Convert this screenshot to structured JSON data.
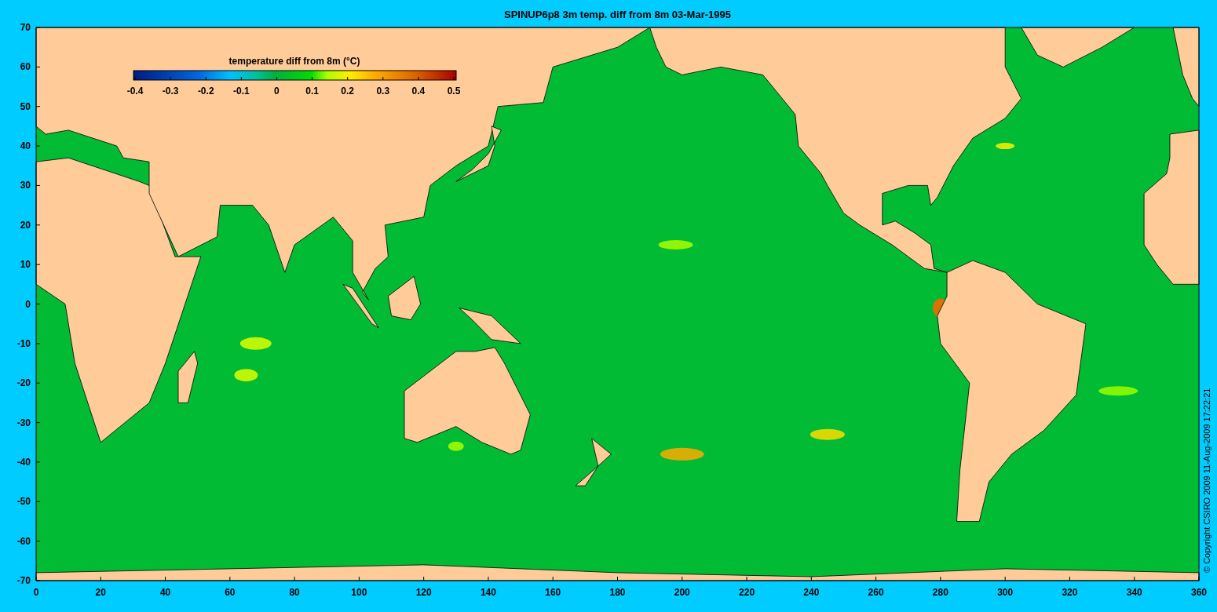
{
  "title": "SPINUP6p8 3m temp.  diff from 8m 03-Mar-1995",
  "colorbar": {
    "label": "temperature  diff from 8m (°C)",
    "ticks": [
      "-0.4",
      "-0.3",
      "-0.2",
      "-0.1",
      "0",
      "0.1",
      "0.2",
      "0.3",
      "0.4",
      "0.5"
    ]
  },
  "y_axis": {
    "ticks": [
      "70",
      "60",
      "50",
      "40",
      "30",
      "20",
      "10",
      "0",
      "-10",
      "-20",
      "-30",
      "-40",
      "-50",
      "-60",
      "-70"
    ]
  },
  "x_axis": {
    "ticks": [
      "0",
      "20",
      "40",
      "60",
      "80",
      "100",
      "120",
      "140",
      "160",
      "180",
      "200",
      "220",
      "240",
      "260",
      "280",
      "300",
      "320",
      "340",
      "360"
    ]
  },
  "copyright": "© Copyright CSIRO 2009   11-Aug-2009 17:22:21"
}
